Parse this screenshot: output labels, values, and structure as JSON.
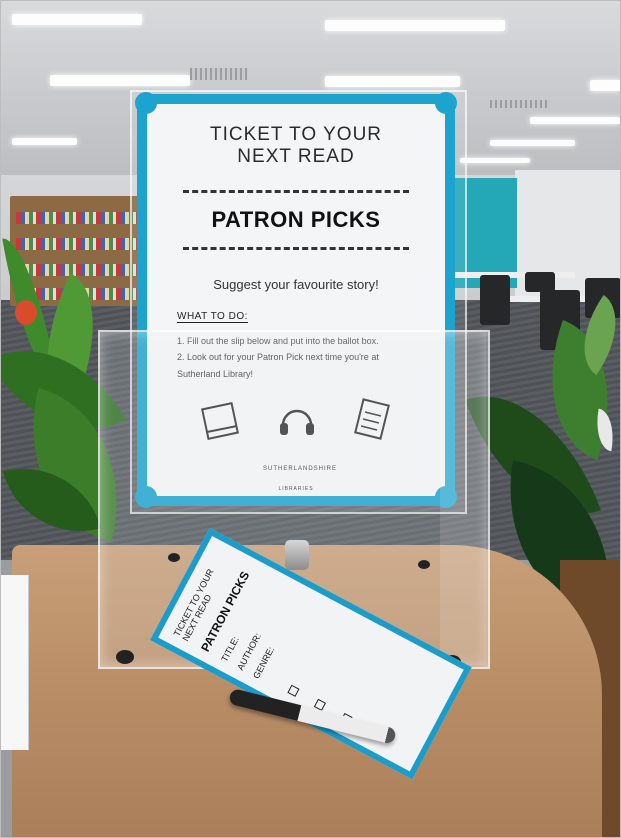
{
  "photo": {
    "poster": {
      "heading_line1": "TICKET TO YOUR",
      "heading_line2": "NEXT READ",
      "title": "PATRON PICKS",
      "subtitle": "Suggest your favourite story!",
      "what_to_do": "WHAT TO DO:",
      "step1": "1.  Fill out the slip below and put into the ballot box.",
      "step2": "2.  Look out for your Patron Pick next time you're at",
      "step2_cont": "Sutherland Library!",
      "icons": [
        "book-icon",
        "headphones-icon",
        "document-icon"
      ],
      "logo_text": "SUTHERLANDSHIRE",
      "logo_sub": "LIBRARIES",
      "accent_color": "#1ca4cf"
    },
    "slip": {
      "heading": "TICKET TO YOUR NEXT READ",
      "title": "PATRON PICKS",
      "field_title": "TITLE:",
      "field_author": "AUTHOR:",
      "field_genre": "GENRE:",
      "accent_color": "#1c9cc9"
    }
  }
}
